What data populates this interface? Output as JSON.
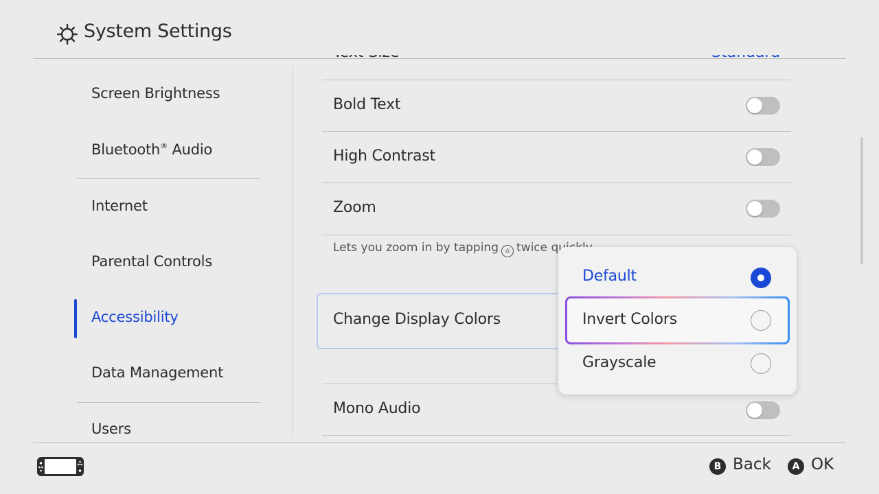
{
  "header": {
    "title": "System Settings",
    "icon": "gear-icon"
  },
  "sidebar": {
    "items": [
      {
        "label": "Screen Brightness"
      },
      {
        "label": "Bluetooth",
        "sup": "®",
        "label_rest": " Audio"
      },
      {
        "label": "Internet"
      },
      {
        "label": "Parental Controls"
      },
      {
        "label": "Accessibility",
        "active": true
      },
      {
        "label": "Data Management"
      },
      {
        "label": "Users"
      }
    ]
  },
  "main": {
    "text_size": {
      "label": "Text Size",
      "value": "Standard"
    },
    "rows": [
      {
        "label": "Bold Text",
        "on": false
      },
      {
        "label": "High Contrast",
        "on": false
      },
      {
        "label": "Zoom",
        "on": false
      },
      {
        "label": "Mono Audio",
        "on": false
      }
    ],
    "zoom_description_before": "Lets you zoom in by tapping",
    "zoom_description_after": "twice quickly.",
    "change_display_colors": "Change Display Colors"
  },
  "popup": {
    "options": [
      {
        "label": "Default",
        "selected": true
      },
      {
        "label": "Invert Colors",
        "selected": false
      },
      {
        "label": "Grayscale",
        "selected": false
      }
    ]
  },
  "footer": {
    "back_button": "B",
    "back_label": "Back",
    "ok_button": "A",
    "ok_label": "OK"
  },
  "colors": {
    "accent": "#1a49d6",
    "background": "#ebebeb"
  }
}
